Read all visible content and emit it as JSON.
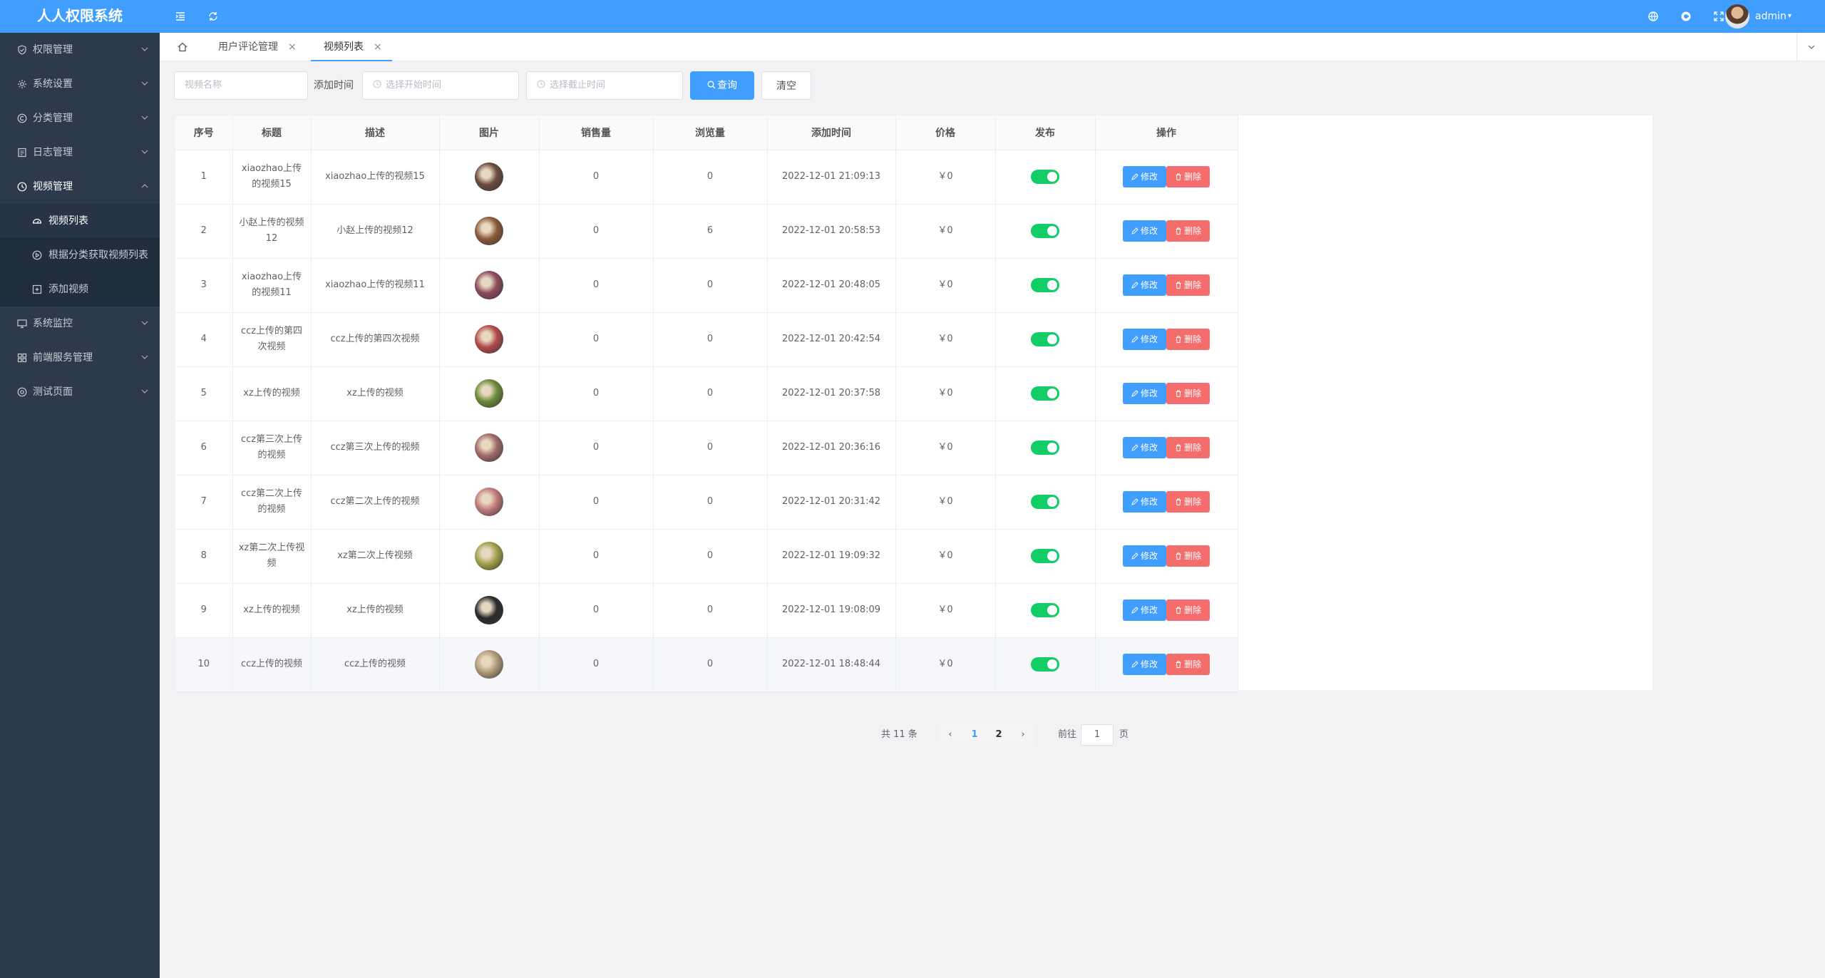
{
  "app": {
    "title": "人人权限系统"
  },
  "header": {
    "user": "admin"
  },
  "sidebar": {
    "items": [
      {
        "label": "权限管理",
        "icon": "shield-icon"
      },
      {
        "label": "系统设置",
        "icon": "gear-icon"
      },
      {
        "label": "分类管理",
        "icon": "copyright-icon"
      },
      {
        "label": "日志管理",
        "icon": "document-icon"
      },
      {
        "label": "视频管理",
        "icon": "clock-icon",
        "open": true,
        "children": [
          {
            "label": "视频列表",
            "icon": "dashboard-icon",
            "active": true
          },
          {
            "label": "根据分类获取视频列表",
            "icon": "play-icon"
          },
          {
            "label": "添加视频",
            "icon": "plus-square-icon"
          }
        ]
      },
      {
        "label": "系统监控",
        "icon": "monitor-icon"
      },
      {
        "label": "前端服务管理",
        "icon": "grid-icon"
      },
      {
        "label": "测试页面",
        "icon": "circle-icon"
      }
    ]
  },
  "tabs": [
    {
      "label": "用户评论管理",
      "active": false
    },
    {
      "label": "视频列表",
      "active": true
    }
  ],
  "filter": {
    "name_placeholder": "视频名称",
    "time_label": "添加时间",
    "start_placeholder": "选择开始时间",
    "end_placeholder": "选择截止时间",
    "search_label": "查询",
    "clear_label": "清空"
  },
  "table": {
    "columns": [
      "序号",
      "标题",
      "描述",
      "图片",
      "销售量",
      "浏览量",
      "添加时间",
      "价格",
      "发布",
      "操作"
    ],
    "edit_label": "修改",
    "delete_label": "删除",
    "rows": [
      {
        "no": "1",
        "title": "xiaozhao上传的视频15",
        "desc": "xiaozhao上传的视频15",
        "sales": "0",
        "views": "0",
        "time": "2022-12-01 21:09:13",
        "price": "￥0",
        "published": true,
        "thumb": "#6b4a3e"
      },
      {
        "no": "2",
        "title": "小赵上传的视频12",
        "desc": "小赵上传的视频12",
        "sales": "0",
        "views": "6",
        "time": "2022-12-01 20:58:53",
        "price": "￥0",
        "published": true,
        "thumb": "#8a5a3a"
      },
      {
        "no": "3",
        "title": "xiaozhao上传的视频11",
        "desc": "xiaozhao上传的视频11",
        "sales": "0",
        "views": "0",
        "time": "2022-12-01 20:48:05",
        "price": "￥0",
        "published": true,
        "thumb": "#8c4a5a"
      },
      {
        "no": "4",
        "title": "ccz上传的第四次视频",
        "desc": "ccz上传的第四次视频",
        "sales": "0",
        "views": "0",
        "time": "2022-12-01 20:42:54",
        "price": "￥0",
        "published": true,
        "thumb": "#b04a4a"
      },
      {
        "no": "5",
        "title": "xz上传的视频",
        "desc": "xz上传的视频",
        "sales": "0",
        "views": "0",
        "time": "2022-12-01 20:37:58",
        "price": "￥0",
        "published": true,
        "thumb": "#6d8a3a"
      },
      {
        "no": "6",
        "title": "ccz第三次上传的视频",
        "desc": "ccz第三次上传的视频",
        "sales": "0",
        "views": "0",
        "time": "2022-12-01 20:36:16",
        "price": "￥0",
        "published": true,
        "thumb": "#a06a6a"
      },
      {
        "no": "7",
        "title": "ccz第二次上传的视频",
        "desc": "ccz第二次上传的视频",
        "sales": "0",
        "views": "0",
        "time": "2022-12-01 20:31:42",
        "price": "￥0",
        "published": true,
        "thumb": "#c07a7a"
      },
      {
        "no": "8",
        "title": "xz第二次上传视频",
        "desc": "xz第二次上传视频",
        "sales": "0",
        "views": "0",
        "time": "2022-12-01 19:09:32",
        "price": "￥0",
        "published": true,
        "thumb": "#a0a04a"
      },
      {
        "no": "9",
        "title": "xz上传的视频",
        "desc": "xz上传的视频",
        "sales": "0",
        "views": "0",
        "time": "2022-12-01 19:08:09",
        "price": "￥0",
        "published": true,
        "thumb": "#2a2a2a"
      },
      {
        "no": "10",
        "title": "ccz上传的视频",
        "desc": "ccz上传的视频",
        "sales": "0",
        "views": "0",
        "time": "2022-12-01 18:48:44",
        "price": "￥0",
        "published": true,
        "thumb": "#b09a7a"
      }
    ]
  },
  "pagination": {
    "total_text": "共 11 条",
    "pages": [
      "1",
      "2"
    ],
    "current": "1",
    "goto_label": "前往",
    "goto_value": "1",
    "page_unit": "页"
  },
  "colors": {
    "accent": "#409eff",
    "sidebar": "#2d3a4b",
    "danger": "#f56c6c",
    "success": "#13ce66"
  }
}
